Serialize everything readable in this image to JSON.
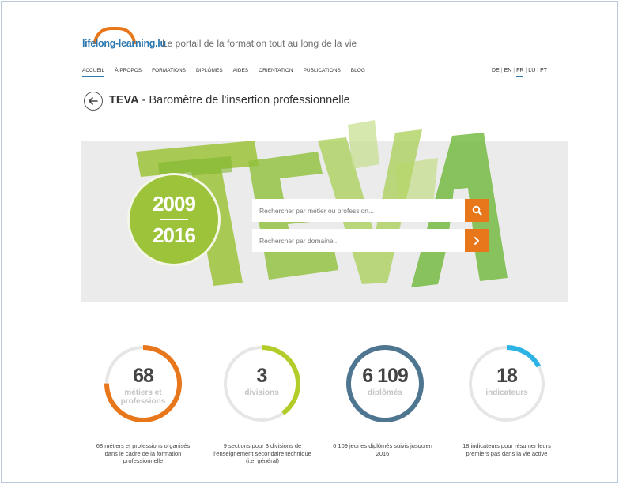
{
  "header": {
    "logo_text": "lifelong-learning.lu",
    "tagline": "Le portail de la formation tout au long de la vie"
  },
  "nav": {
    "items": [
      "ACCUEIL",
      "À PROPOS",
      "FORMATIONS",
      "DIPLÔMES",
      "AIDES",
      "ORIENTATION",
      "PUBLICATIONS",
      "BLOG"
    ],
    "active": "ACCUEIL"
  },
  "languages": {
    "items": [
      "DE",
      "EN",
      "FR",
      "LU",
      "PT"
    ],
    "active": "FR"
  },
  "page": {
    "title_bold": "TEVA",
    "title_rest": " - Baromètre de l'insertion professionnelle",
    "back_icon": "arrow-left-circle-icon"
  },
  "hero": {
    "watermark": "TEVA",
    "year_start": "2009",
    "year_end": "2016",
    "search_placeholder": "Rechercher par métier ou profession...",
    "domain_placeholder": "Rechercher par domaine...",
    "colors": {
      "accent": "#e8761b",
      "green": "#9cc33a",
      "background": "#ebebeb"
    }
  },
  "stats": [
    {
      "value": "68",
      "label": "métiers et professions",
      "description": "68 métiers et professions organisés dans le cadre de la formation professionnelle",
      "color": "#e8761b",
      "fraction": 0.75
    },
    {
      "value": "3",
      "label": "divisions",
      "description": "9 sections pour 3 divisions de l'enseignement secondaire technique (i.e. général)",
      "color": "#b3cc2a",
      "fraction": 0.4
    },
    {
      "value": "6 109",
      "label": "diplômés",
      "description": "6 109 jeunes diplômés suivis jusqu'en 2016",
      "color": "#4f7691",
      "fraction": 1.0
    },
    {
      "value": "18",
      "label": "indicateurs",
      "description": "18 indicateurs pour résumer leurs premiers pas dans la vie active",
      "color": "#2bb3e6",
      "fraction": 0.17
    }
  ]
}
